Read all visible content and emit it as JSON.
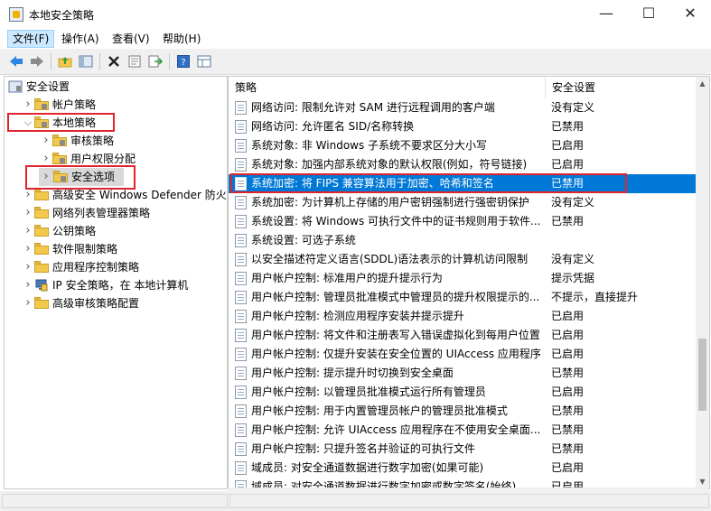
{
  "window": {
    "title": "本地安全策略",
    "minimize_glyph": "—",
    "maximize_glyph": "☐",
    "close_glyph": "✕"
  },
  "menu": [
    "文件(F)",
    "操作(A)",
    "查看(V)",
    "帮助(H)"
  ],
  "toolbar": {
    "buttons": [
      "back-icon",
      "forward-icon",
      "up-folder-icon",
      "show-tree-icon",
      "delete-icon",
      "properties-icon",
      "export-icon",
      "help-icon",
      "view-icon"
    ]
  },
  "tree": [
    {
      "label": "安全设置",
      "level": 0,
      "expanded": true
    },
    {
      "label": "帐户策略",
      "level": 1,
      "expanded": false
    },
    {
      "label": "本地策略",
      "level": 1,
      "expanded": true
    },
    {
      "label": "审核策略",
      "level": 2,
      "expanded": false
    },
    {
      "label": "用户权限分配",
      "level": 2,
      "expanded": false
    },
    {
      "label": "安全选项",
      "level": 2,
      "expanded": false,
      "selected": true
    },
    {
      "label": "高级安全 Windows Defender 防火墙",
      "level": 1,
      "expanded": false
    },
    {
      "label": "网络列表管理器策略",
      "level": 1,
      "expanded": false
    },
    {
      "label": "公钥策略",
      "level": 1,
      "expanded": false
    },
    {
      "label": "软件限制策略",
      "level": 1,
      "expanded": false
    },
    {
      "label": "应用程序控制策略",
      "level": 1,
      "expanded": false
    },
    {
      "label": "IP 安全策略，在 本地计算机",
      "level": 1,
      "expanded": false
    },
    {
      "label": "高级审核策略配置",
      "level": 1,
      "expanded": false
    }
  ],
  "list": {
    "columns": [
      "策略",
      "安全设置"
    ],
    "rows": [
      {
        "policy": "网络访问: 限制允许对 SAM 进行远程调用的客户端",
        "setting": "没有定义"
      },
      {
        "policy": "网络访问: 允许匿名 SID/名称转换",
        "setting": "已禁用"
      },
      {
        "policy": "系统对象: 非 Windows 子系统不要求区分大小写",
        "setting": "已启用"
      },
      {
        "policy": "系统对象: 加强内部系统对象的默认权限(例如，符号链接)",
        "setting": "已启用"
      },
      {
        "policy": "系统加密: 将 FIPS 兼容算法用于加密、哈希和签名",
        "setting": "已禁用",
        "selected": true
      },
      {
        "policy": "系统加密: 为计算机上存储的用户密钥强制进行强密钥保护",
        "setting": "没有定义"
      },
      {
        "policy": "系统设置: 将 Windows 可执行文件中的证书规则用于软件...",
        "setting": "已禁用"
      },
      {
        "policy": "系统设置: 可选子系统",
        "setting": ""
      },
      {
        "policy": "以安全描述符定义语言(SDDL)语法表示的计算机访问限制",
        "setting": "没有定义"
      },
      {
        "policy": "用户帐户控制: 标准用户的提升提示行为",
        "setting": "提示凭据"
      },
      {
        "policy": "用户帐户控制: 管理员批准模式中管理员的提升权限提示的...",
        "setting": "不提示，直接提升"
      },
      {
        "policy": "用户帐户控制: 检测应用程序安装并提示提升",
        "setting": "已启用"
      },
      {
        "policy": "用户帐户控制: 将文件和注册表写入错误虚拟化到每用户位置",
        "setting": "已启用"
      },
      {
        "policy": "用户帐户控制: 仅提升安装在安全位置的 UIAccess 应用程序",
        "setting": "已启用"
      },
      {
        "policy": "用户帐户控制: 提示提升时切换到安全桌面",
        "setting": "已禁用"
      },
      {
        "policy": "用户帐户控制: 以管理员批准模式运行所有管理员",
        "setting": "已启用"
      },
      {
        "policy": "用户帐户控制: 用于内置管理员帐户的管理员批准模式",
        "setting": "已禁用"
      },
      {
        "policy": "用户帐户控制: 允许 UIAccess 应用程序在不使用安全桌面...",
        "setting": "已禁用"
      },
      {
        "policy": "用户帐户控制: 只提升签名并验证的可执行文件",
        "setting": "已禁用"
      },
      {
        "policy": "域成员: 对安全通道数据进行数字加密(如果可能)",
        "setting": "已启用"
      },
      {
        "policy": "域成员: 对安全通道数据进行数字加密或数字签名(始终)",
        "setting": "已启用"
      }
    ]
  },
  "colors": {
    "selection": "#0078d7",
    "highlight_box": "#e0242b",
    "folder": "#f2c94c"
  }
}
